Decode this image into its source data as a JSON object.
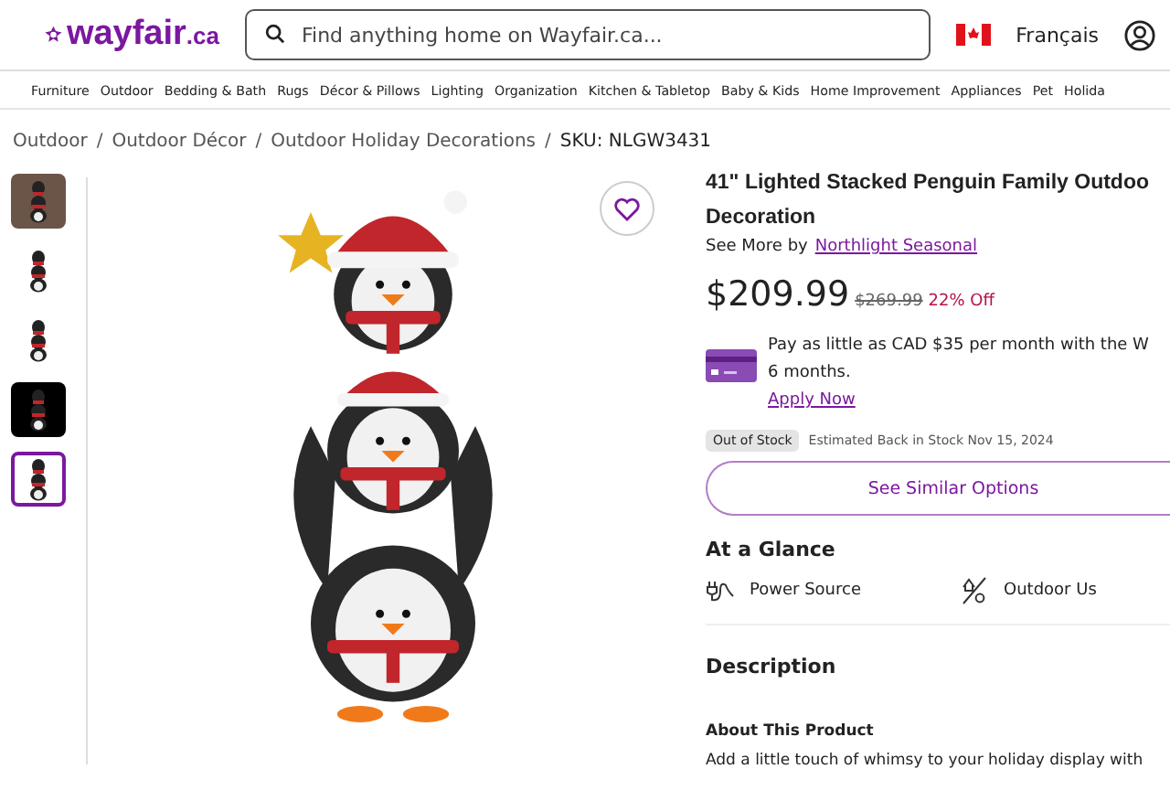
{
  "header": {
    "logo": {
      "name": "wayfair",
      "suffix": ".ca"
    },
    "search": {
      "placeholder": "Find anything home on Wayfair.ca..."
    },
    "language": "Français"
  },
  "nav": [
    "Furniture",
    "Outdoor",
    "Bedding & Bath",
    "Rugs",
    "Décor & Pillows",
    "Lighting",
    "Organization",
    "Kitchen & Tabletop",
    "Baby & Kids",
    "Home Improvement",
    "Appliances",
    "Pet",
    "Holida"
  ],
  "breadcrumb": [
    "Outdoor",
    "Outdoor Décor",
    "Outdoor Holiday Decorations",
    "SKU: NLGW3431"
  ],
  "breadcrumb_separator": "/",
  "thumbnails": [
    {
      "kind": "scene",
      "selected": false
    },
    {
      "kind": "cutout",
      "selected": false
    },
    {
      "kind": "cutout",
      "selected": false
    },
    {
      "kind": "night",
      "selected": false
    },
    {
      "kind": "cutout",
      "selected": true
    }
  ],
  "favorite": {
    "saved": false
  },
  "product": {
    "title_lines": [
      "41\" Lighted Stacked Penguin Family Outdoo",
      "Decoration"
    ],
    "brand_prefix": "See More by",
    "brand": "Northlight Seasonal",
    "price": "$209.99",
    "was_price": "$269.99",
    "discount": "22% Off",
    "financing": {
      "lines": [
        "Pay as little as CAD $35 per month with the W",
        "6 months."
      ],
      "link": "Apply Now"
    },
    "stock_badge": "Out of Stock",
    "stock_note": "Estimated Back in Stock Nov 15, 2024",
    "similar_button": "See Similar Options"
  },
  "glance": {
    "title": "At a Glance",
    "items": [
      {
        "kind": "plug",
        "label": "Power Source"
      },
      {
        "kind": "weather",
        "label": "Outdoor Us"
      }
    ]
  },
  "description": {
    "title": "Description",
    "subtitle": "About This Product",
    "text": "Add a little touch of whimsy to your holiday display with"
  }
}
